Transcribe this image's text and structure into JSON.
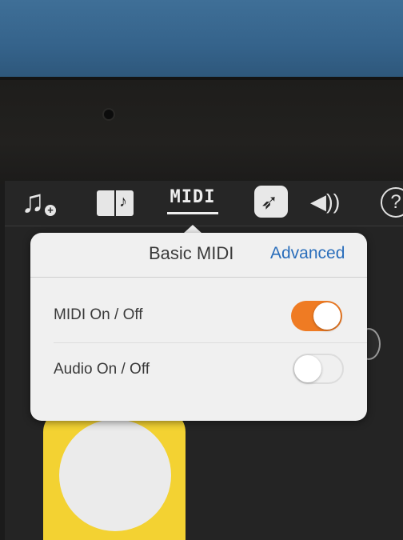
{
  "toolbar": {
    "items": [
      {
        "name": "music-note-plus-icon",
        "glyph": "♫",
        "badge": "+"
      },
      {
        "name": "songbook-icon",
        "glyph": "♪"
      },
      {
        "name": "midi-icon",
        "label": "MIDI",
        "selected": true
      },
      {
        "name": "swift-icon",
        "glyph": "➶"
      },
      {
        "name": "speaker-icon",
        "glyph": "◀︎))"
      },
      {
        "name": "help-icon",
        "glyph": "?"
      }
    ]
  },
  "popover": {
    "title": "Basic MIDI",
    "advanced_label": "Advanced",
    "rows": [
      {
        "label": "MIDI On / Off",
        "on": true
      },
      {
        "label": "Audio On / Off",
        "on": false
      }
    ],
    "accent_color": "#ef7b23",
    "link_color": "#2a6ebb"
  }
}
